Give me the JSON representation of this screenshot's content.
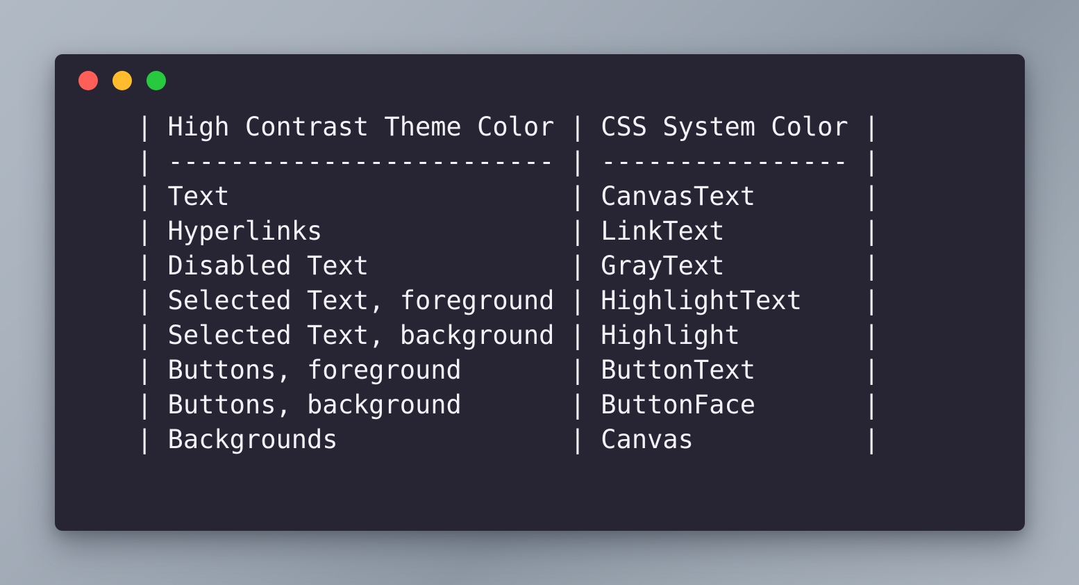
{
  "window": {
    "background_color": "#272433",
    "text_color": "#f2f2f7",
    "traffic_lights": [
      {
        "name": "close",
        "label": "Close",
        "color": "#ff5f56"
      },
      {
        "name": "minimize",
        "label": "Minimize",
        "color": "#ffbd2e"
      },
      {
        "name": "maximize",
        "label": "Maximize",
        "color": "#27c93f"
      }
    ]
  },
  "console": {
    "table": {
      "border_char": "|",
      "separator_char": "-",
      "left_column_width": 25,
      "right_column_width": 16,
      "headers": [
        "High Contrast Theme Color",
        "CSS System Color"
      ],
      "separator_row": [
        "-------------------------",
        "----------------"
      ],
      "rows": [
        [
          "Text",
          "CanvasText"
        ],
        [
          "Hyperlinks",
          "LinkText"
        ],
        [
          "Disabled Text",
          "GrayText"
        ],
        [
          "Selected Text, foreground",
          "HighlightText"
        ],
        [
          "Selected Text, background",
          "Highlight"
        ],
        [
          "Buttons, foreground",
          "ButtonText"
        ],
        [
          "Buttons, background",
          "ButtonFace"
        ],
        [
          "Backgrounds",
          "Canvas"
        ]
      ]
    },
    "lines": [
      "| High Contrast Theme Color | CSS System Color |",
      "| ------------------------- | ---------------- |",
      "| Text                      | CanvasText       |",
      "| Hyperlinks                | LinkText         |",
      "| Disabled Text             | GrayText         |",
      "| Selected Text, foreground | HighlightText    |",
      "| Selected Text, background | Highlight        |",
      "| Buttons, foreground       | ButtonText       |",
      "| Buttons, background       | ButtonFace       |",
      "| Backgrounds               | Canvas           |"
    ]
  }
}
